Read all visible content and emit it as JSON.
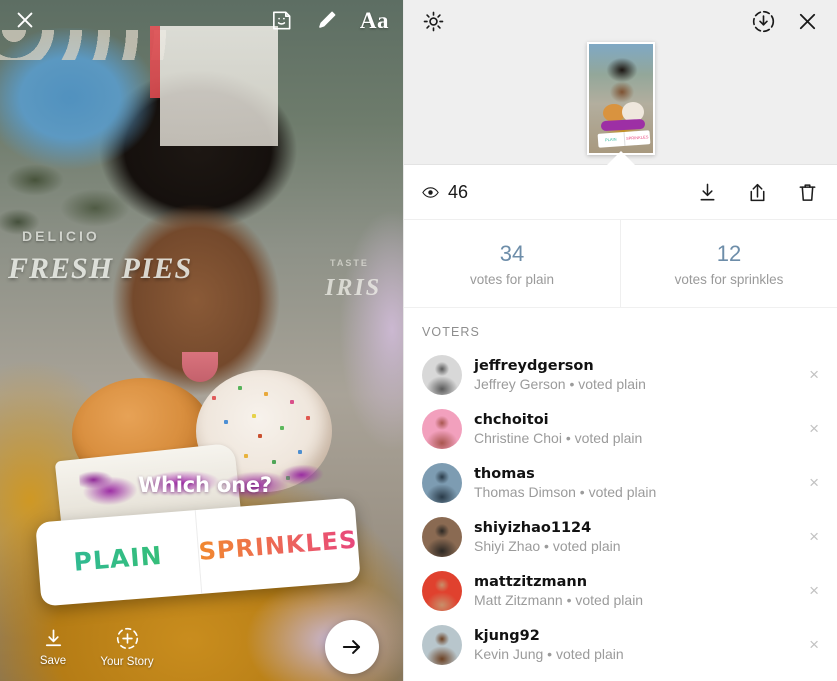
{
  "story_composer": {
    "toolbar_top": {
      "close_label": "close-icon",
      "sticker_label": "sticker-icon",
      "draw_label": "pen-icon",
      "text_label": "Aa"
    },
    "photo": {
      "storefront_text_1": "DELICIO",
      "storefront_text_2": "FRESH PIES",
      "storefront_text_3": "TASTE",
      "storefront_text_4": "IRIS"
    },
    "poll": {
      "question": "Which one?",
      "option_left": "PLAIN",
      "option_right": "SPRINKLES"
    },
    "toolbar_bottom": {
      "save_label": "Save",
      "your_story_label": "Your Story",
      "next_label": "next-arrow"
    }
  },
  "insights": {
    "header": {
      "settings_label": "settings-gear",
      "download_label": "download-circle",
      "close_label": "close"
    },
    "actions": {
      "views_count": "46",
      "download_label": "download",
      "share_label": "share",
      "delete_label": "delete"
    },
    "stats": [
      {
        "count": "34",
        "label": "votes for plain"
      },
      {
        "count": "12",
        "label": "votes for sprinkles"
      }
    ],
    "voters_section_title": "VOTERS",
    "voters": [
      {
        "username": "jeffreydgerson",
        "subtitle": "Jeffrey Gerson • voted plain",
        "avatar_color_a": "#d8d8d8",
        "avatar_color_b": "#5a5a5a"
      },
      {
        "username": "chchoitoi",
        "subtitle": "Christine Choi • voted plain",
        "avatar_color_a": "#f2a0bd",
        "avatar_color_b": "#a9564f"
      },
      {
        "username": "thomas",
        "subtitle": "Thomas Dimson • voted plain",
        "avatar_color_a": "#7d9cb2",
        "avatar_color_b": "#2a3b49"
      },
      {
        "username": "shiyizhao1124",
        "subtitle": "Shiyi Zhao • voted plain",
        "avatar_color_a": "#8a6a52",
        "avatar_color_b": "#2c2824"
      },
      {
        "username": "mattzitzmann",
        "subtitle": "Matt Zitzmann • voted plain",
        "avatar_color_a": "#e0412e",
        "avatar_color_b": "#c88f6a"
      },
      {
        "username": "kjung92",
        "subtitle": "Kevin Jung • voted plain",
        "avatar_color_a": "#b8c6cc",
        "avatar_color_b": "#6b4022"
      }
    ],
    "remove_voter_label": "×"
  }
}
